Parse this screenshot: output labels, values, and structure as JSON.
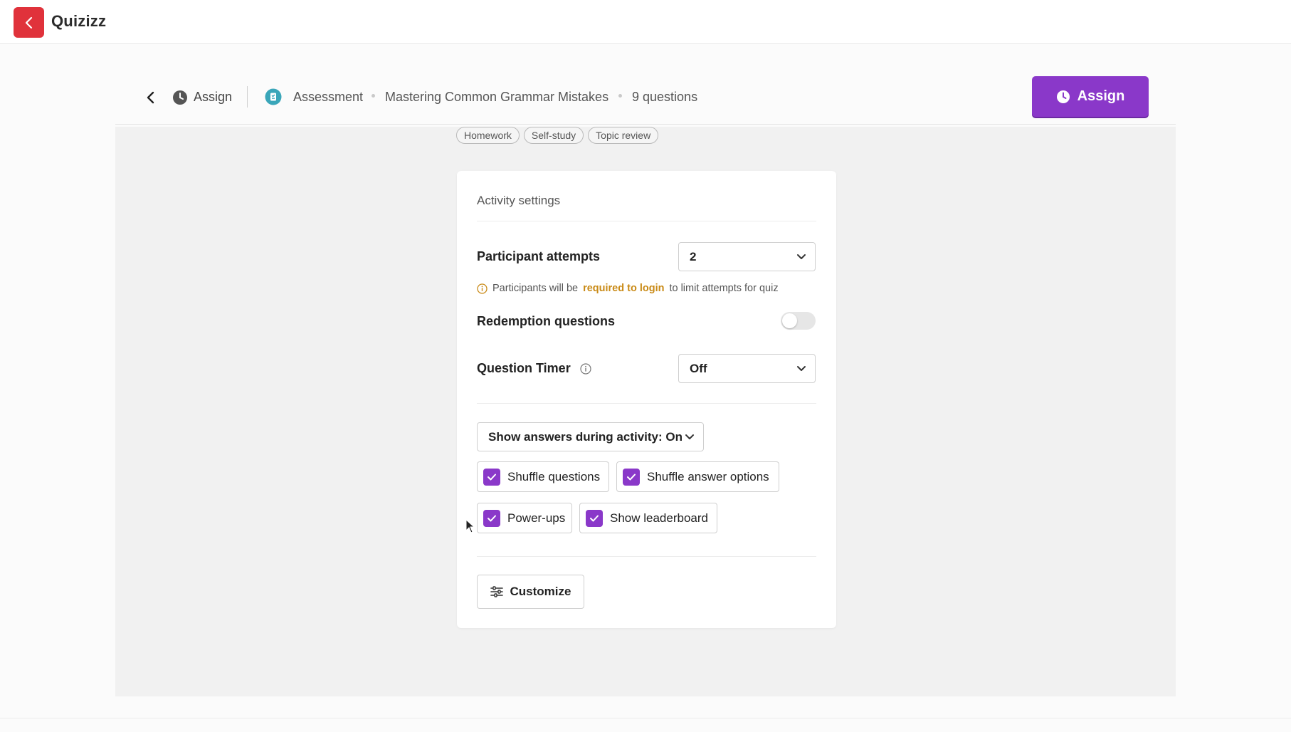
{
  "app": {
    "name": "Quizizz"
  },
  "header": {
    "assign_crumb": "Assign",
    "type": "Assessment",
    "title": "Mastering Common Grammar Mistakes",
    "count": "9 questions",
    "assign_button": "Assign"
  },
  "chips": [
    "Homework",
    "Self-study",
    "Topic review"
  ],
  "settings": {
    "heading": "Activity settings",
    "attempts_label": "Participant attempts",
    "attempts_value": "2",
    "login_note_pre": "Participants will be",
    "login_note_link": "required to login",
    "login_note_post": "to limit attempts for quiz",
    "redemption_label": "Redemption questions",
    "redemption_on": false,
    "timer_label": "Question Timer",
    "timer_value": "Off",
    "show_answers": "Show answers during activity: On",
    "checkboxes": [
      {
        "label": "Shuffle questions",
        "checked": true
      },
      {
        "label": "Shuffle answer options",
        "checked": true
      },
      {
        "label": "Power-ups",
        "checked": true
      },
      {
        "label": "Show leaderboard",
        "checked": true
      }
    ],
    "customize": "Customize"
  },
  "colors": {
    "brand_red": "#e0323b",
    "accent_purple": "#8a38c9",
    "note_orange": "#c98a16"
  }
}
